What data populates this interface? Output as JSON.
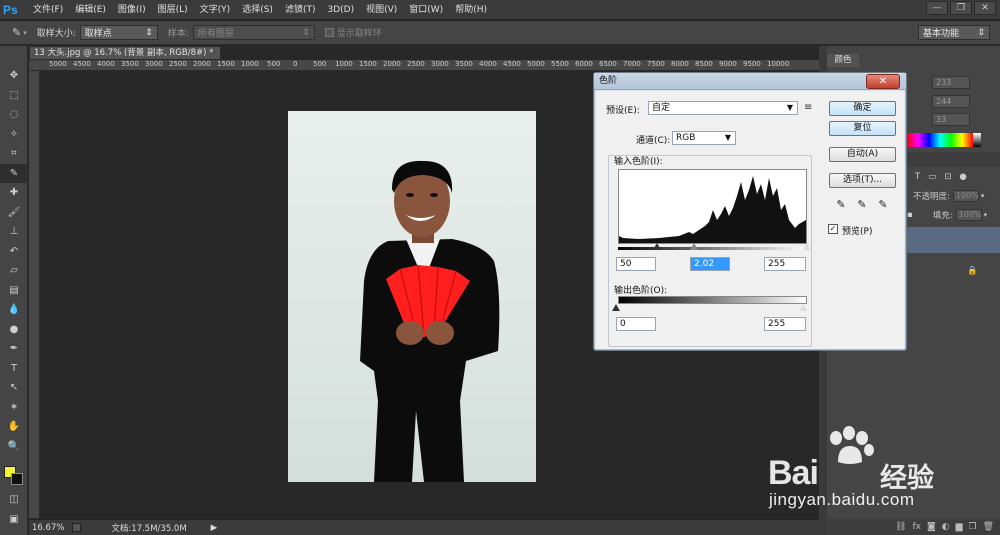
{
  "app": {
    "logo": "Ps",
    "menu": [
      "文件(F)",
      "编辑(E)",
      "图像(I)",
      "图层(L)",
      "文字(Y)",
      "选择(S)",
      "滤镜(T)",
      "3D(D)",
      "视图(V)",
      "窗口(W)",
      "帮助(H)"
    ],
    "window_controls": [
      "—",
      "❐",
      "✕"
    ]
  },
  "options": {
    "sample_size_label": "取样大小:",
    "sample_size_value": "取样点",
    "sample_label": "样本:",
    "sample_value": "所有图层",
    "show_ring_label": "显示取样环",
    "workspace": "基本功能"
  },
  "document": {
    "tab_title": "13 大头.jpg @ 16.7% (背景 副本, RGB/8#) *",
    "ruler_ticks": [
      "5000",
      "4500",
      "4000",
      "3500",
      "3000",
      "2500",
      "2000",
      "1500",
      "1000",
      "500",
      "0",
      "500",
      "1000",
      "1500",
      "2000",
      "2500",
      "3000",
      "3500",
      "4000",
      "4500",
      "5000",
      "5500",
      "6000",
      "6500",
      "7000",
      "7500",
      "8000",
      "8500",
      "9000",
      "9500",
      "10000"
    ],
    "zoom": "16.67%",
    "doc_info": "文档:17.5M/35.0M"
  },
  "panels": {
    "color_tab": "颜色",
    "color_values": [
      "233",
      "244",
      "33"
    ],
    "opacity_label": "不透明度:",
    "opacity_value": "100%",
    "fill_label": "填充:",
    "fill_value": "100%"
  },
  "levels": {
    "title": "色阶",
    "close": "✕",
    "preset_label": "预设(E):",
    "preset_value": "自定",
    "channel_label": "通道(C):",
    "channel_value": "RGB",
    "input_label": "输入色阶(I):",
    "input_black": "50",
    "input_gamma": "2.02",
    "input_white": "255",
    "output_label": "输出色阶(O):",
    "output_black": "0",
    "output_white": "255",
    "buttons": {
      "ok": "确定",
      "reset": "复位",
      "auto": "自动(A)",
      "options": "选项(T)..."
    },
    "preview_label": "预览(P)",
    "preview_checked": true
  },
  "watermark": {
    "brand": "Bai",
    "brand2": "经验",
    "url": "jingyan.baidu.com"
  }
}
